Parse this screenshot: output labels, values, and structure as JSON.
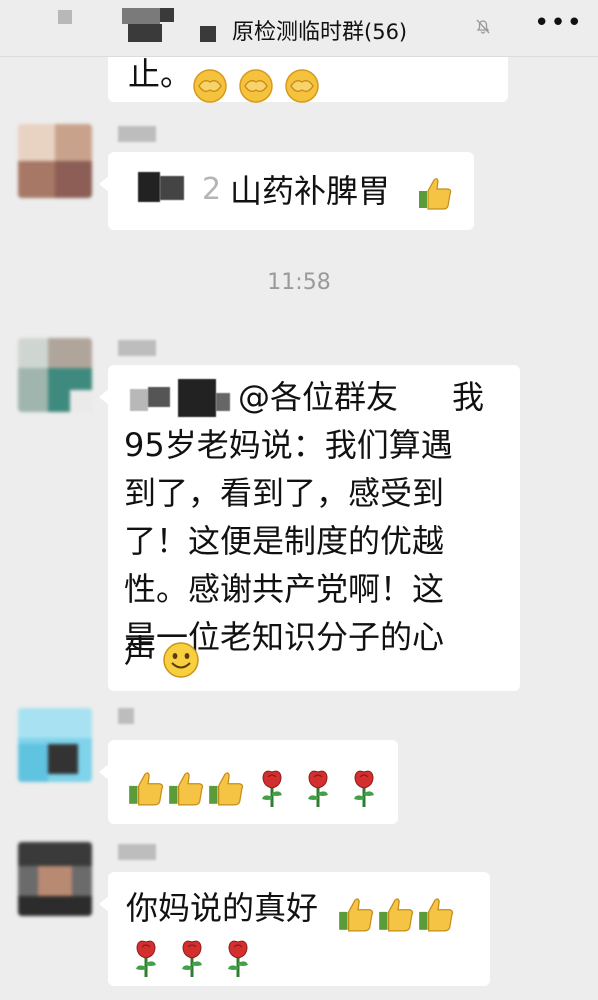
{
  "header": {
    "title": "原检测临时群",
    "member_count": "(56)",
    "more": "•••"
  },
  "messages": [
    {
      "text_tail": "止。",
      "emojis": [
        "facepalm",
        "facepalm",
        "facepalm"
      ]
    },
    {
      "text_prefix": "2",
      "text": "山药补脾胃",
      "emojis": [
        "thumbs-up"
      ]
    },
    {
      "time": "11:58"
    },
    {
      "mention": "@各位群友",
      "lines": [
        "我",
        "95岁老妈说：我们算遇",
        "到了，看到了，感受到",
        "了！这便是制度的优越",
        "性。感谢共产党啊！这",
        "是一位老知识分子的心",
        "声"
      ],
      "emojis": [
        "smile"
      ]
    },
    {
      "emojis": [
        "thumbs-up",
        "thumbs-up",
        "thumbs-up",
        "rose",
        "rose",
        "rose"
      ]
    },
    {
      "text": "你妈说的真好",
      "emojis": [
        "thumbs-up",
        "thumbs-up",
        "thumbs-up",
        "rose",
        "rose",
        "rose"
      ]
    }
  ],
  "colors": {
    "background": "#ededed",
    "bubble": "#ffffff",
    "time": "#9a9a9a"
  }
}
